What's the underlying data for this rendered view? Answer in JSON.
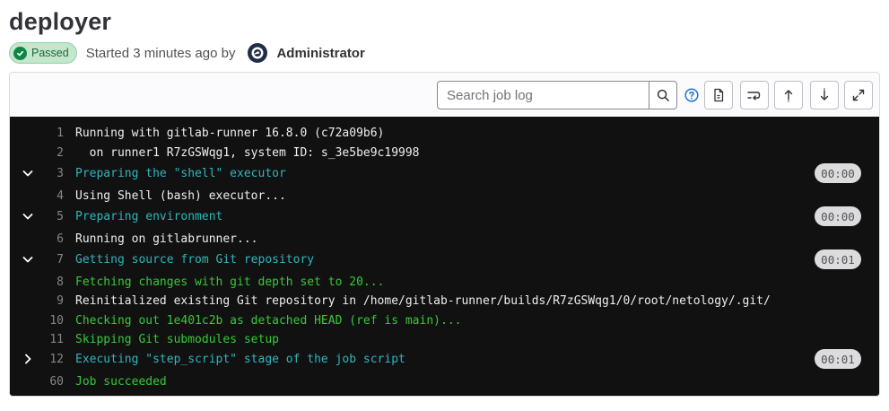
{
  "job": {
    "title": "deployer",
    "status": "Passed",
    "started": "Started 3 minutes ago by",
    "author": "Administrator"
  },
  "toolbar": {
    "search_placeholder": "Search job log"
  },
  "colors": {
    "log_background": "#111111",
    "section_header": "#2eb6bd",
    "success_text": "#35c93a",
    "badge_green": "#108548"
  },
  "log_lines": [
    {
      "num": "1",
      "text": "Running with gitlab-runner 16.8.0 (c72a09b6)",
      "color": "white"
    },
    {
      "num": "2",
      "text": "  on runner1 R7zGSWqg1, system ID: s_3e5be9c19998",
      "color": "white"
    },
    {
      "num": "3",
      "text": "Preparing the \"shell\" executor",
      "color": "cyan",
      "section": "expanded",
      "duration": "00:00"
    },
    {
      "num": "4",
      "text": "Using Shell (bash) executor...",
      "color": "white"
    },
    {
      "num": "5",
      "text": "Preparing environment",
      "color": "cyan",
      "section": "expanded",
      "duration": "00:00"
    },
    {
      "num": "6",
      "text": "Running on gitlabrunner...",
      "color": "white"
    },
    {
      "num": "7",
      "text": "Getting source from Git repository",
      "color": "cyan",
      "section": "expanded",
      "duration": "00:01"
    },
    {
      "num": "8",
      "text": "Fetching changes with git depth set to 20...",
      "color": "green"
    },
    {
      "num": "9",
      "text": "Reinitialized existing Git repository in /home/gitlab-runner/builds/R7zGSWqg1/0/root/netology/.git/",
      "color": "white"
    },
    {
      "num": "10",
      "text": "Checking out 1e401c2b as detached HEAD (ref is main)...",
      "color": "green"
    },
    {
      "num": "11",
      "text": "Skipping Git submodules setup",
      "color": "green"
    },
    {
      "num": "12",
      "text": "Executing \"step_script\" stage of the job script",
      "color": "cyan",
      "section": "collapsed",
      "duration": "00:01"
    },
    {
      "num": "60",
      "text": "Job succeeded",
      "color": "green"
    }
  ]
}
